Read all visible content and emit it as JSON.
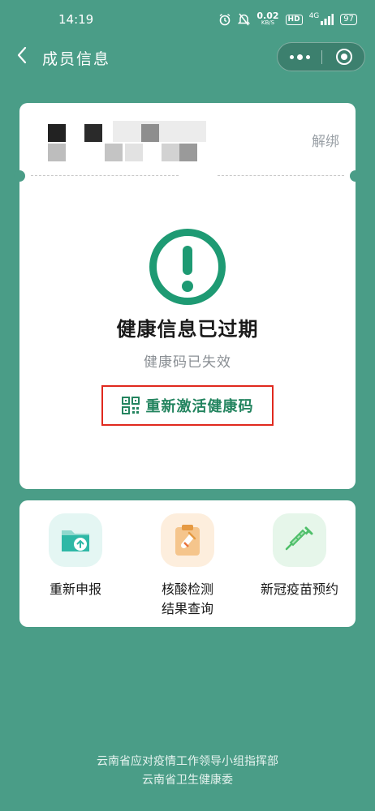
{
  "status_bar": {
    "time": "14:19",
    "speed_value": "0.02",
    "speed_unit": "KB/S",
    "hd_badge": "HD",
    "network": "4G",
    "battery": "97"
  },
  "nav": {
    "title": "成员信息"
  },
  "member_card": {
    "unbind_label": "解绑",
    "status_title": "健康信息已过期",
    "status_subtitle": "健康码已失效",
    "reactivate_label": "重新激活健康码"
  },
  "services": [
    {
      "label": "重新申报",
      "icon": "folder-upload-icon",
      "color": "#2eb8a6"
    },
    {
      "label": "核酸检测\n结果查询",
      "icon": "clipboard-test-tube-icon",
      "color": "#f0a04b"
    },
    {
      "label": "新冠疫苗预约",
      "icon": "syringe-icon",
      "color": "#4fbf6a"
    }
  ],
  "footer": {
    "line1": "云南省应对疫情工作领导小组指挥部",
    "line2": "云南省卫生健康委"
  },
  "colors": {
    "background": "#4a9d87",
    "accent_green": "#1e9a73",
    "highlight_red": "#e0291e"
  }
}
